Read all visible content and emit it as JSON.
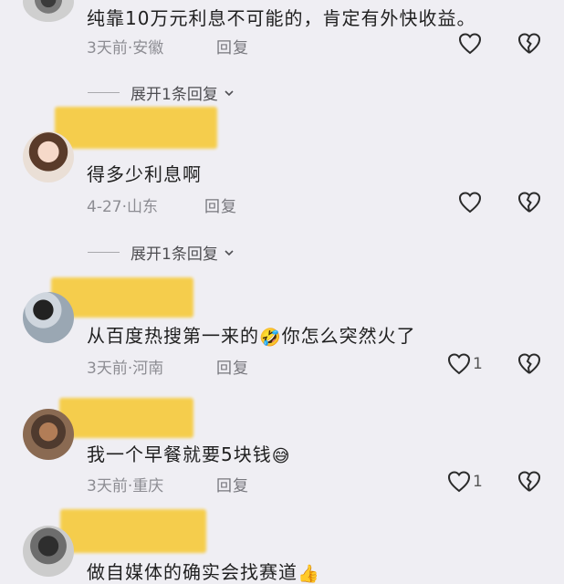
{
  "comments": [
    {
      "text": "纯靠10万元利息不可能的，肯定有外快收益。",
      "time": "3天前",
      "location": "安徽",
      "reply_label": "回复",
      "likes": ""
    },
    {
      "text": "得多少利息啊",
      "time": "4-27",
      "location": "山东",
      "reply_label": "回复",
      "likes": ""
    },
    {
      "text_before": "从百度热搜第一来的",
      "emoji": "🤣",
      "text_after": "你怎么突然火了",
      "time": "3天前",
      "location": "河南",
      "reply_label": "回复",
      "likes": "1"
    },
    {
      "text_before": "我一个早餐就要5块钱",
      "emoji": "😅",
      "time": "3天前",
      "location": "重庆",
      "reply_label": "回复",
      "likes": "1"
    },
    {
      "text_before": "做自媒体的确实会找赛道",
      "emoji": "👍"
    }
  ],
  "expand_replies_label": "展开1条回复",
  "colors": {
    "background": "#efeef3",
    "redaction": "#f6cc44",
    "meta": "#8d8d93"
  },
  "icons": [
    "heart-icon",
    "broken-heart-icon",
    "chevron-down-icon"
  ]
}
